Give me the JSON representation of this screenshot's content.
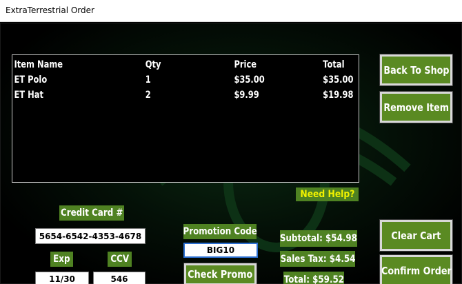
{
  "window": {
    "title": "ExtraTerrestrial Order"
  },
  "cart": {
    "columns": {
      "name": "Item Name",
      "qty": "Qty",
      "price": "Price",
      "total": "Total"
    },
    "items": [
      {
        "name": "ET Polo",
        "qty": "1",
        "price": "$35.00",
        "total": "$35.00"
      },
      {
        "name": "ET Hat",
        "qty": "2",
        "price": "$9.99",
        "total": "$19.98"
      }
    ]
  },
  "buttons": {
    "back_to_shop": "Back To Shop",
    "remove_item": "Remove Item",
    "clear_cart": "Clear Cart",
    "confirm_order": "Confirm Order",
    "check_promo": "Check Promo"
  },
  "help_label": "Need Help?",
  "payment": {
    "card_label": "Credit Card #",
    "card_value": "5654-6542-4353-4678",
    "exp_label": "Exp",
    "exp_value": "11/30",
    "ccv_label": "CCV",
    "ccv_value": "546"
  },
  "promo": {
    "label": "Promotion Code",
    "value": "BIG10"
  },
  "totals": {
    "subtotal": "Subtotal: $54.98",
    "sales_tax": "Sales Tax: $4.54",
    "total": "Total: $59.52"
  },
  "colors": {
    "accent_green": "#5a8a22",
    "help_text": "#f2f200",
    "background": "#000000"
  }
}
